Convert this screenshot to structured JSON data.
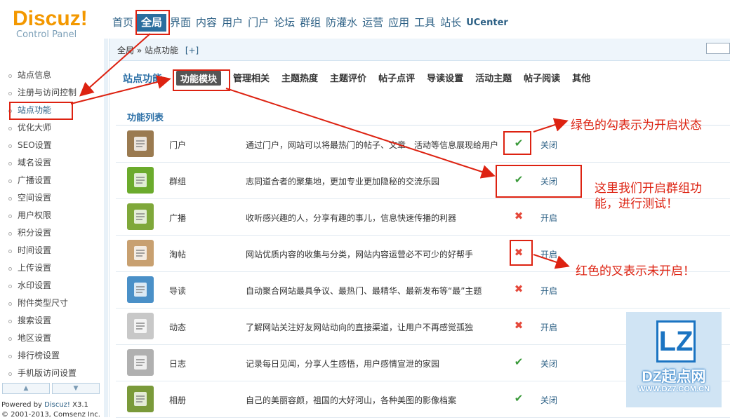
{
  "logo": {
    "brand": "Discuz!",
    "sub": "Control Panel"
  },
  "topnav": [
    "首页",
    "全局",
    "界面",
    "内容",
    "用户",
    "门户",
    "论坛",
    "群组",
    "防灌水",
    "运营",
    "应用",
    "工具",
    "站长",
    "UCenter"
  ],
  "breadcrumb": {
    "text": "全局 » 站点功能",
    "plus": "[+]"
  },
  "sidebar": {
    "items": [
      "站点信息",
      "注册与访问控制",
      "站点功能",
      "优化大师",
      "SEO设置",
      "域名设置",
      "广播设置",
      "空间设置",
      "用户权限",
      "积分设置",
      "时间设置",
      "上传设置",
      "水印设置",
      "附件类型尺寸",
      "搜索设置",
      "地区设置",
      "排行榜设置",
      "手机版访问设置"
    ],
    "active_index": 2,
    "scroll_up": "▲",
    "scroll_down": "▼"
  },
  "powered": {
    "prefix": "Powered by ",
    "name": "Discuz!",
    "version": " X3.1",
    "copyright": "© 2001-2013, Comsenz Inc."
  },
  "subnav": {
    "title": "站点功能",
    "tabs": [
      "功能模块",
      "管理相关",
      "主题热度",
      "主题评价",
      "帖子点评",
      "导读设置",
      "活动主题",
      "帖子阅读",
      "其他"
    ]
  },
  "list": {
    "header": "功能列表",
    "rows": [
      {
        "name": "门户",
        "desc": "通过门户，网站可以将最热门的帖子、文章、活动等信息展现给用户",
        "enabled": true,
        "action": "关闭",
        "icon": "portal-icon",
        "color": "#9a7a50"
      },
      {
        "name": "群组",
        "desc": "志同道合者的聚集地，更加专业更加隐秘的交流乐园",
        "enabled": true,
        "action": "关闭",
        "icon": "group-icon",
        "color": "#6bab2c"
      },
      {
        "name": "广播",
        "desc": "收听感兴趣的人，分享有趣的事儿，信息快速传播的利器",
        "enabled": false,
        "action": "开启",
        "icon": "broadcast-icon",
        "color": "#7fa83a"
      },
      {
        "name": "淘帖",
        "desc": "网站优质内容的收集与分类，网站内容运营必不可少的好帮手",
        "enabled": false,
        "action": "开启",
        "icon": "collection-icon",
        "color": "#c8a070"
      },
      {
        "name": "导读",
        "desc": "自动聚合网站最具争议、最热门、最精华、最新发布等“最”主题",
        "enabled": false,
        "action": "开启",
        "icon": "guide-icon",
        "color": "#4a90c8"
      },
      {
        "name": "动态",
        "desc": "了解网站关注好友网站动向的直接渠道，让用户不再感觉孤独",
        "enabled": false,
        "action": "开启",
        "icon": "feed-icon",
        "color": "#c8c8c8"
      },
      {
        "name": "日志",
        "desc": "记录每日见闻，分享人生感悟，用户感情宣泄的家园",
        "enabled": true,
        "action": "关闭",
        "icon": "blog-icon",
        "color": "#b0b0b0"
      },
      {
        "name": "相册",
        "desc": "自己的美丽容颜，祖国的大好河山，各种美图的影像档案",
        "enabled": true,
        "action": "关闭",
        "icon": "album-icon",
        "color": "#7a9a3a"
      }
    ]
  },
  "annotations": {
    "green_note": "绿色的勾表示为开启状态",
    "group_note": "这里我们开启群组功能，进行测试！",
    "red_note": "红色的叉表示未开启！",
    "color": "#dd2211"
  },
  "watermark": {
    "badge": "LZ",
    "name": "DZ起点网",
    "url": "WWW.DZ7.COM.CN"
  }
}
